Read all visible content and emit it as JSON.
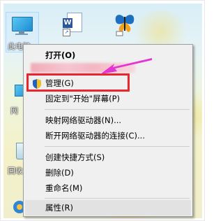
{
  "desktop": {
    "this_pc_label": "此电脑",
    "network_label": "网",
    "recycle_label": "回收",
    "word_icon_letter": "W",
    "icons": [
      "this-pc-icon",
      "word-shortcut-icon",
      "butterfly-icon",
      "network-icon",
      "recycle-bin-icon",
      "taskbar-app-icon"
    ]
  },
  "context_menu": {
    "items": [
      {
        "label": "打开(O)",
        "bold": true
      },
      {
        "label": "管理(G)",
        "icon": "shield-icon"
      },
      {
        "label": "固定到\"开始\"屏幕(P)"
      },
      {
        "label": "映射网络驱动器(N)..."
      },
      {
        "label": "断开网络驱动器的连接(C)..."
      },
      {
        "label": "创建快捷方式(S)"
      },
      {
        "label": "删除(D)"
      },
      {
        "label": "重命名(M)"
      },
      {
        "label": "属性(R)"
      }
    ]
  },
  "annotation": {
    "highlight_color": "#e8262c",
    "arrow_color": "#e235d2"
  }
}
